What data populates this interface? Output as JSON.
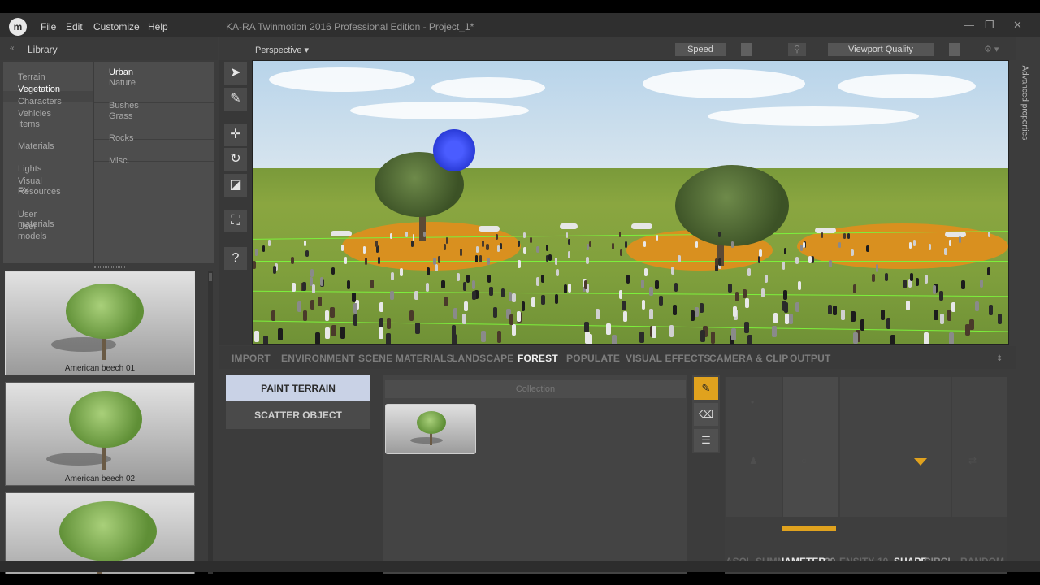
{
  "menubar": {
    "logo": "m",
    "items": [
      "File",
      "Edit",
      "Customize",
      "Help"
    ],
    "title": "KA-RA Twinmotion 2016 Professional Edition - Project_1*",
    "window_controls": [
      "—",
      "❐",
      "✕"
    ]
  },
  "library": {
    "title": "Library",
    "categories": [
      "Terrain",
      "Vegetation",
      "Characters",
      "Vehicles",
      "Items",
      "Materials",
      "Lights",
      "Visual FX",
      "Resources",
      "User materials",
      "User models"
    ],
    "selected_category": "Vegetation",
    "subcategories": [
      "Urban",
      "Nature",
      "Bushes",
      "Grass",
      "Rocks",
      "Misc."
    ],
    "selected_subcategory": "Urban",
    "thumbnails": [
      {
        "label": "American beech 01"
      },
      {
        "label": "American beech 02"
      },
      {
        "label": ""
      }
    ]
  },
  "viewport": {
    "mode": "Perspective ▾",
    "speed_label": "Speed",
    "quality_label": "Viewport Quality",
    "advanced_label": "Advanced properties"
  },
  "tools": {
    "icons": [
      "select-arrow-icon",
      "eyedropper-icon",
      "move-icon",
      "rotate-icon",
      "scale-icon",
      "fullscreen-icon",
      "help-icon"
    ]
  },
  "tabs": [
    "IMPORT",
    "ENVIRONMENT",
    "SCENE MATERIALS",
    "LANDSCAPE",
    "FOREST",
    "POPULATE",
    "VISUAL EFFECTS",
    "CAMERA & CLIP",
    "OUTPUT"
  ],
  "active_tab": "FOREST",
  "forest": {
    "paint_terrain": "PAINT TERRAIN",
    "scatter_object": "SCATTER OBJECT",
    "collection_label": "Collection"
  },
  "sliders": {
    "labels": [
      "ASON",
      "SUMM",
      "IAMETER",
      "39",
      "ENSITY",
      "10",
      "SHAPE",
      "CIRCL",
      "RANDOM"
    ]
  },
  "colors": {
    "accent": "#e0a21e",
    "paint_terrain_bg": "#c9d2e6",
    "brush": "#2a3bd8"
  }
}
